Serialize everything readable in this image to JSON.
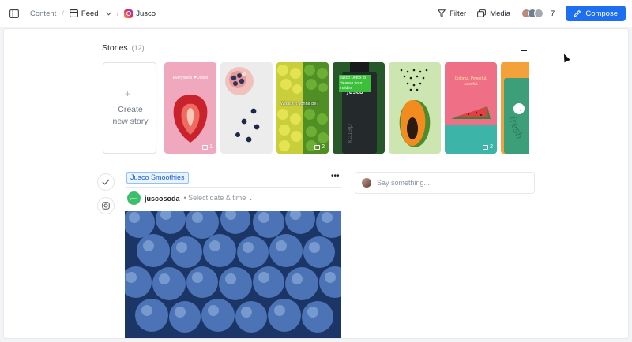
{
  "breadcrumb": {
    "content": "Content",
    "feed": "Feed",
    "channel": "Jusco"
  },
  "toolbar": {
    "filter_label": "Filter",
    "media_label": "Media",
    "collaborators_count": "7",
    "compose_label": "Compose"
  },
  "colors": {
    "accent": "#1e6ef0",
    "tag_bg": "#eaf3ff",
    "tag_text": "#1c5fc7"
  },
  "stories": {
    "title": "Stories",
    "count": "(12)",
    "create_label_line1": "Create",
    "create_label_line2": "new story",
    "items": [
      {
        "text": "Everyone's ❤ Jusco",
        "comments": "1"
      },
      {
        "text": "",
        "comments": ""
      },
      {
        "text": "What's it gonna be?",
        "comments": "2"
      },
      {
        "text": "Jusco Detox to cleanse your insides",
        "comments": ""
      },
      {
        "text": "",
        "comments": ""
      },
      {
        "text": "Colorful. Powerful. Juiceful.",
        "comments": "2"
      },
      {
        "text": "",
        "comments": ""
      }
    ]
  },
  "post": {
    "tag": "Jusco Smoothies",
    "account": "juscosoda",
    "date_placeholder": "Select date & time",
    "logo_text": "jusco"
  },
  "comments": {
    "placeholder": "Say something..."
  }
}
